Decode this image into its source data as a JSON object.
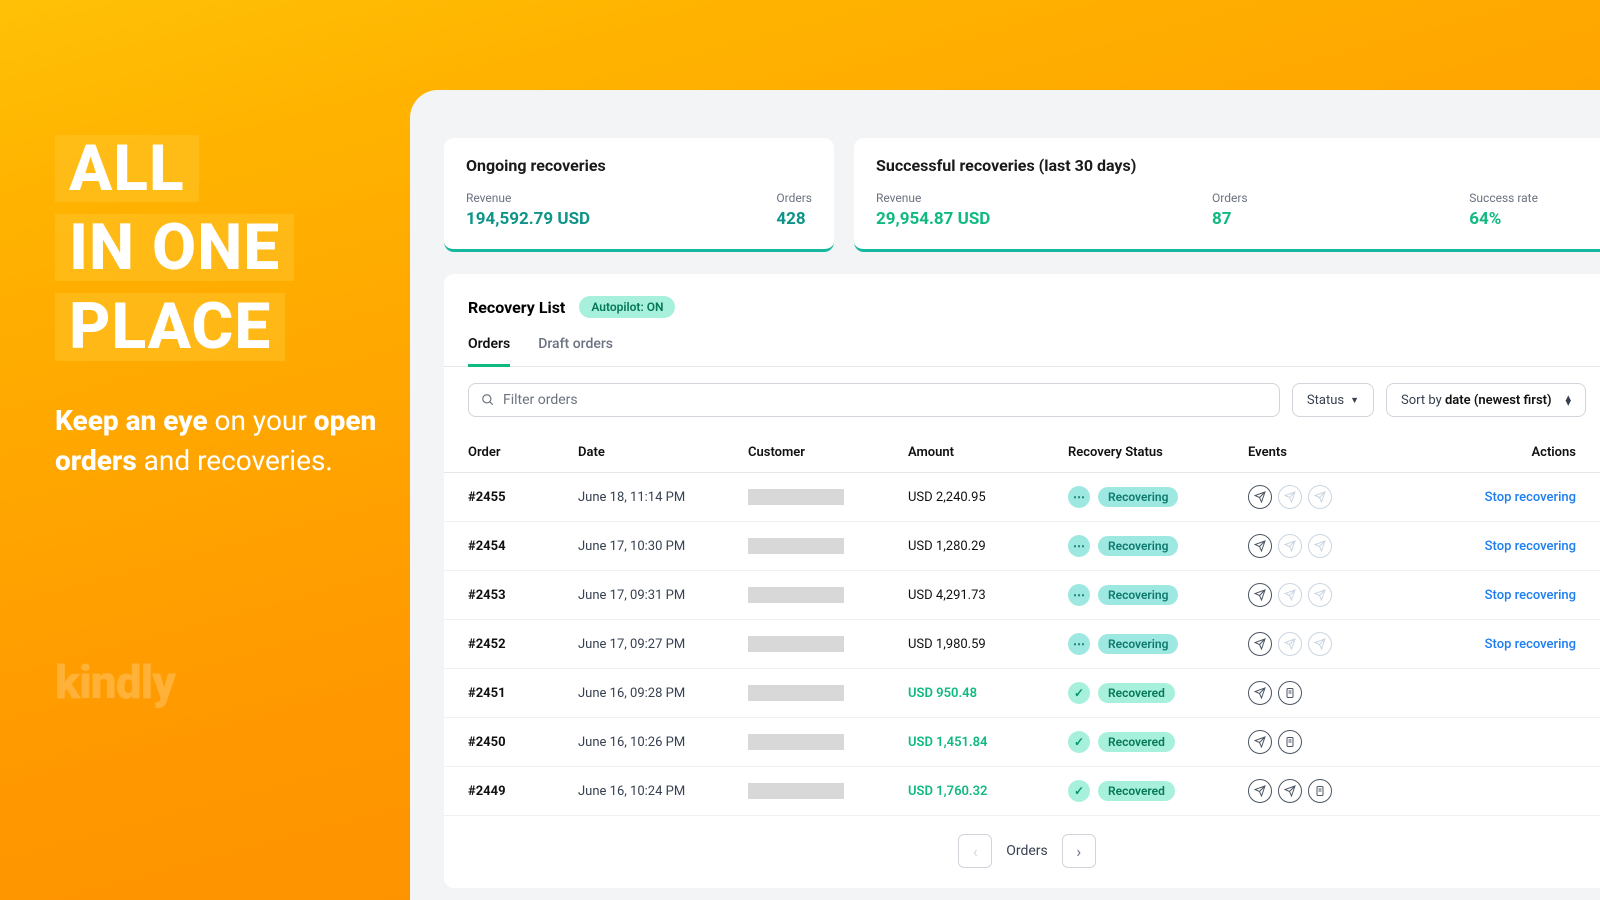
{
  "promo": {
    "line1": "ALL",
    "line2": "IN ONE",
    "line3": "PLACE",
    "copy_b1": "Keep an eye",
    "copy_t1": " on your ",
    "copy_b2": "open orders",
    "copy_t2": " and recoveries.",
    "logo": "kindly"
  },
  "cards": {
    "ongoing": {
      "title": "Ongoing recoveries",
      "revenue_label": "Revenue",
      "revenue": "194,592.79 USD",
      "orders_label": "Orders",
      "orders": "428"
    },
    "success": {
      "title": "Successful recoveries (last 30 days)",
      "revenue_label": "Revenue",
      "revenue": "29,954.87 USD",
      "orders_label": "Orders",
      "orders": "87",
      "rate_label": "Success rate",
      "rate": "64%"
    }
  },
  "list": {
    "title": "Recovery List",
    "autopilot": "Autopilot: ON",
    "tabs": {
      "orders": "Orders",
      "drafts": "Draft orders"
    },
    "filter_placeholder": "Filter orders",
    "status_btn": "Status",
    "sort_prefix": "Sort by ",
    "sort_value": "date (newest first)",
    "cols": {
      "order": "Order",
      "date": "Date",
      "customer": "Customer",
      "amount": "Amount",
      "status": "Recovery Status",
      "events": "Events",
      "actions": "Actions"
    },
    "stop_label": "Stop recovering",
    "status_recovering": "Recovering",
    "status_recovered": "Recovered",
    "rows": [
      {
        "order": "#2455",
        "date": "June 18, 11:14 PM",
        "amount": "USD 2,240.95",
        "recovered": false,
        "events": [
          "send",
          "send-dim",
          "send-dim"
        ],
        "action": true
      },
      {
        "order": "#2454",
        "date": "June 17, 10:30 PM",
        "amount": "USD 1,280.29",
        "recovered": false,
        "events": [
          "send",
          "send-dim",
          "send-dim"
        ],
        "action": true
      },
      {
        "order": "#2453",
        "date": "June 17, 09:31 PM",
        "amount": "USD 4,291.73",
        "recovered": false,
        "events": [
          "send",
          "send-dim",
          "send-dim"
        ],
        "action": true
      },
      {
        "order": "#2452",
        "date": "June 17, 09:27 PM",
        "amount": "USD 1,980.59",
        "recovered": false,
        "events": [
          "send",
          "send-dim",
          "send-dim"
        ],
        "action": true
      },
      {
        "order": "#2451",
        "date": "June 16, 09:28 PM",
        "amount": "USD 950.48",
        "recovered": true,
        "events": [
          "send",
          "doc"
        ],
        "action": false
      },
      {
        "order": "#2450",
        "date": "June 16, 10:26 PM",
        "amount": "USD 1,451.84",
        "recovered": true,
        "events": [
          "send",
          "doc"
        ],
        "action": false
      },
      {
        "order": "#2449",
        "date": "June 16, 10:24 PM",
        "amount": "USD 1,760.32",
        "recovered": true,
        "events": [
          "send",
          "send",
          "doc"
        ],
        "action": false
      }
    ],
    "pager_label": "Orders"
  }
}
